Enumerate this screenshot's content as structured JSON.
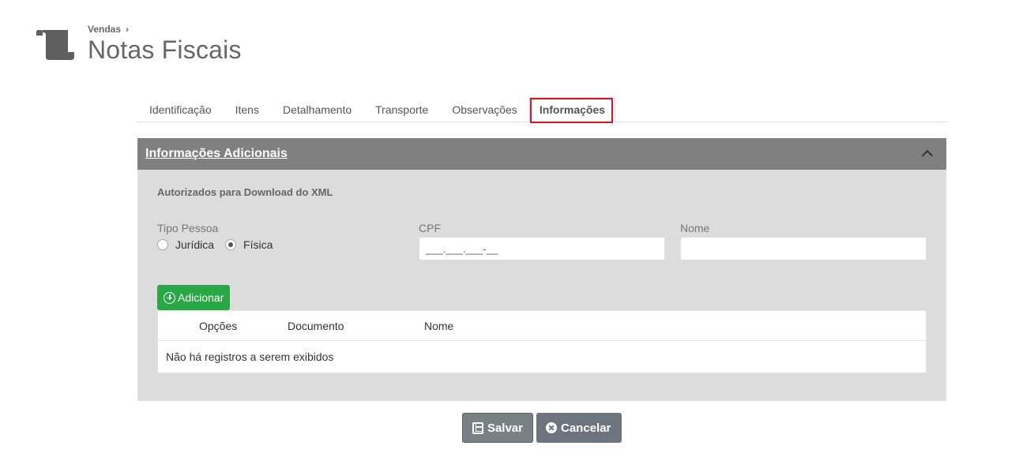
{
  "header": {
    "breadcrumb": "Vendas",
    "breadcrumb_separator": "›",
    "title": "Notas Fiscais",
    "icon": "scroll-icon"
  },
  "tabs": [
    {
      "label": "Identificação",
      "active": false
    },
    {
      "label": "Itens",
      "active": false
    },
    {
      "label": "Detalhamento",
      "active": false
    },
    {
      "label": "Transporte",
      "active": false
    },
    {
      "label": "Observações",
      "active": false
    },
    {
      "label": "Informações",
      "active": true
    }
  ],
  "panel": {
    "title": "Informações Adicionais",
    "section_title": "Autorizados para Download do XML",
    "tipo_pessoa": {
      "label": "Tipo Pessoa",
      "options": [
        "Jurídica",
        "Física"
      ],
      "selected": "Física"
    },
    "cpf": {
      "label": "CPF",
      "value": "___.___.___-__"
    },
    "nome": {
      "label": "Nome",
      "value": ""
    },
    "add_button": "Adicionar",
    "table": {
      "columns": [
        "Opções",
        "Documento",
        "Nome"
      ],
      "empty_message": "Não há registros a serem exibidos"
    }
  },
  "footer": {
    "save_label": "Salvar",
    "cancel_label": "Cancelar"
  },
  "colors": {
    "panel_header": "#808080",
    "panel_body": "#dcdcdc",
    "add_button": "#28a745",
    "action_button": "#6c757d",
    "highlight": "#e0141e"
  }
}
